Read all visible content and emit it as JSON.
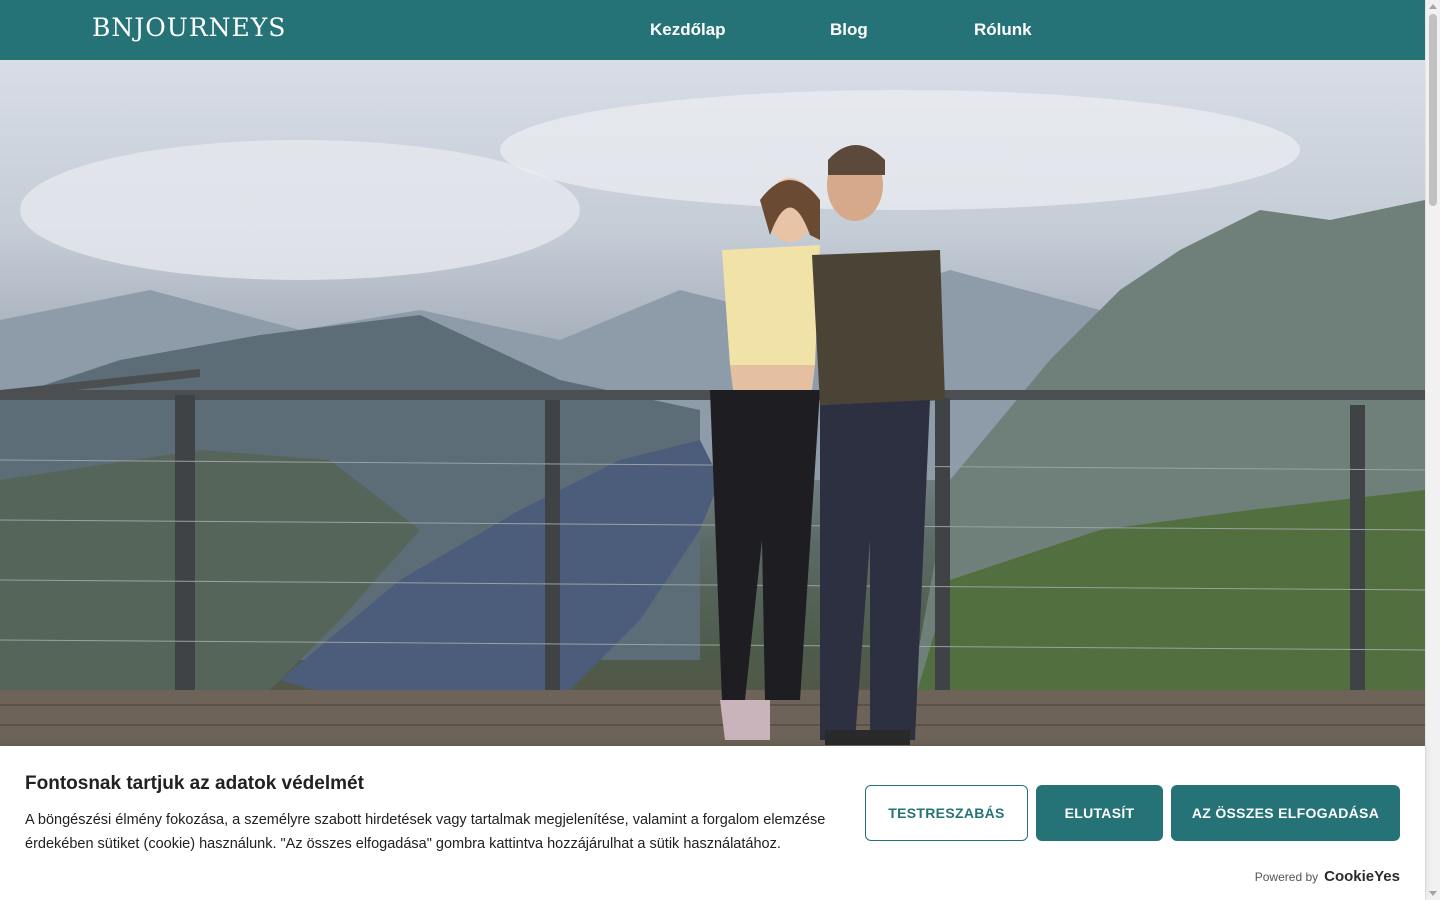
{
  "nav": {
    "logo": "BNJOURNEYS",
    "links": [
      {
        "label": "Kezdőlap"
      },
      {
        "label": "Blog"
      },
      {
        "label": "Rólunk"
      }
    ]
  },
  "colors": {
    "brand_teal": "#267377",
    "white": "#ffffff"
  },
  "hero": {
    "image_description_icon": "hero-photo"
  },
  "cookie": {
    "title": "Fontosnak tartjuk az adatok védelmét",
    "description": "A böngészési élmény fokozása, a személyre szabott hirdetések vagy tartalmak megjelenítése, valamint a forgalom elemzése érdekében sütiket (cookie) használunk. \"Az összes elfogadása\" gombra kattintva hozzájárulhat a sütik használatához.",
    "customize_label": "TESTRESZABÁS",
    "reject_label": "ELUTASÍT",
    "accept_all_label": "AZ ÖSSZES ELFOGADÁSA",
    "powered_by": "Powered by",
    "brand": "CookieYes"
  }
}
